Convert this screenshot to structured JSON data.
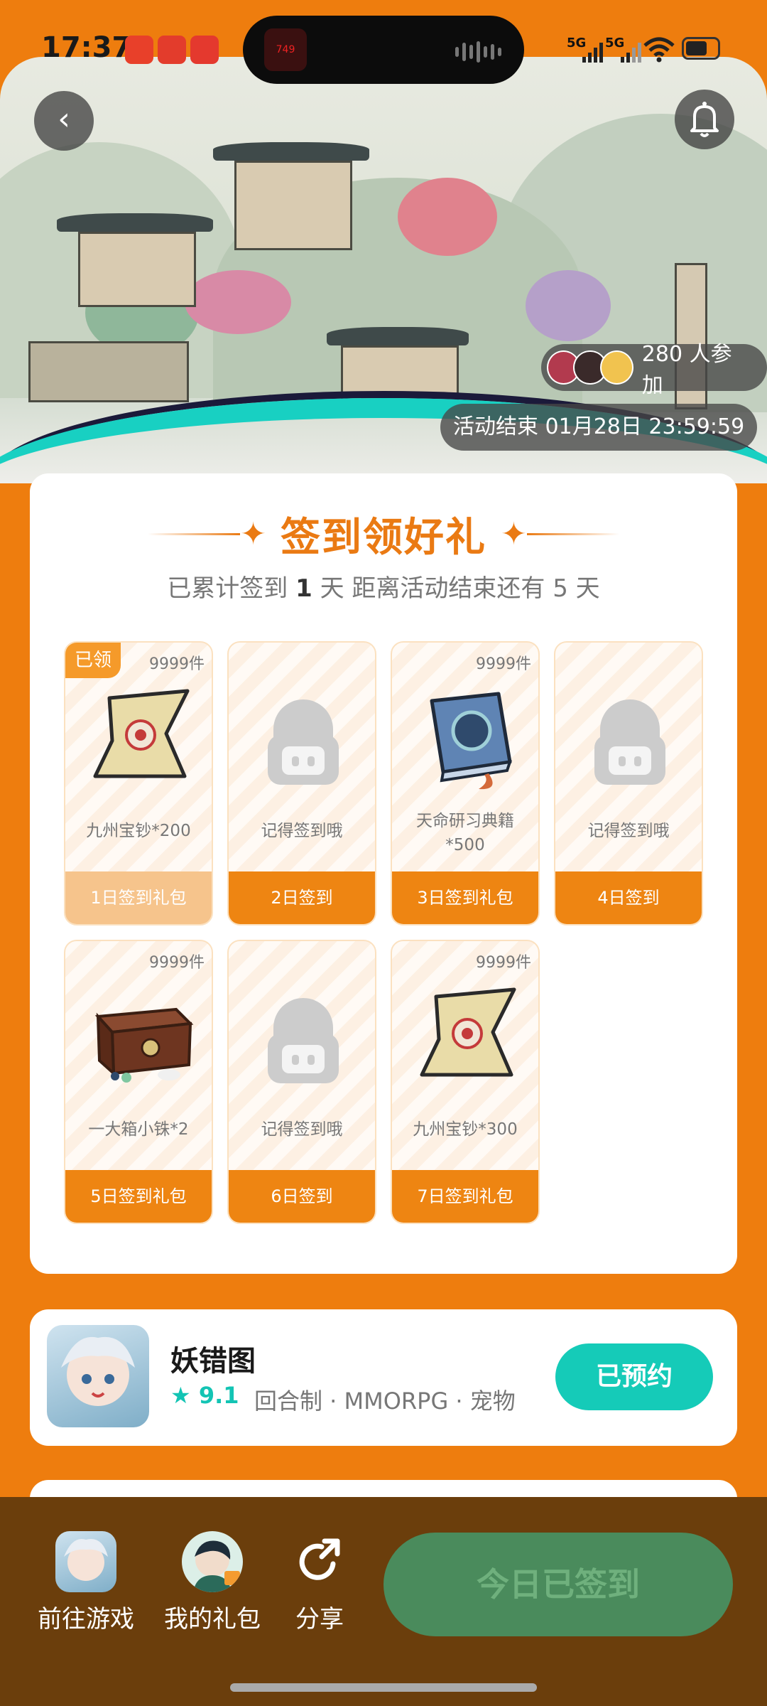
{
  "status_bar": {
    "time": "17:37",
    "island_thumb_text": "749",
    "signal_1": "5G",
    "signal_2": "5G"
  },
  "banner": {
    "participants_text": "280 人参加",
    "end_time": "活动结束 01月28日 23:59:59"
  },
  "checkin": {
    "title": "签到领好礼",
    "subtitle_prefix": "已累计签到",
    "days_signed": "1",
    "subtitle_mid": "天  距离活动结束还有 5 天",
    "claimed_label": "已领",
    "gifts": [
      {
        "stock": "9999件",
        "name": "九州宝钞*200",
        "footer": "1日签到礼包",
        "claimed": true
      },
      {
        "stock": "",
        "name": "记得签到哦",
        "footer": "2日签到",
        "claimed": false
      },
      {
        "stock": "9999件",
        "name_line1": "天命研习典籍",
        "name_line2": "*500",
        "footer": "3日签到礼包",
        "claimed": false
      },
      {
        "stock": "",
        "name": "记得签到哦",
        "footer": "4日签到",
        "claimed": false
      },
      {
        "stock": "9999件",
        "name": "一大箱小铢*2",
        "footer": "5日签到礼包",
        "claimed": false
      },
      {
        "stock": "",
        "name": "记得签到哦",
        "footer": "6日签到",
        "claimed": false
      },
      {
        "stock": "9999件",
        "name": "九州宝钞*300",
        "footer": "7日签到礼包",
        "claimed": false
      }
    ]
  },
  "game": {
    "name": "妖错图",
    "rating": "9.1",
    "tags": "回合制 · MMORPG · 宠物",
    "reserve_label": "已预约"
  },
  "bottom_bar": {
    "go_game": "前往游戏",
    "my_gifts": "我的礼包",
    "share": "分享",
    "signed_today": "今日已签到"
  },
  "colors": {
    "accent_orange": "#ea7a13",
    "teal": "#15cbb8",
    "bottom_bar": "#6b3e0c",
    "signed_button": "#4a8b5c"
  }
}
